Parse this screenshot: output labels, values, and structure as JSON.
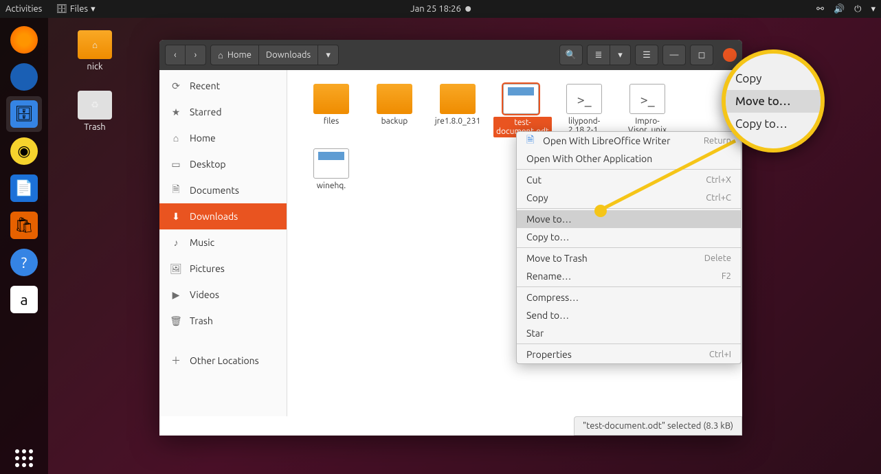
{
  "topbar": {
    "activities": "Activities",
    "app_label": "Files",
    "datetime": "Jan 25  18:26"
  },
  "desktop": {
    "home_label": "nick",
    "trash_label": "Trash"
  },
  "dock": {
    "firefox": "Firefox",
    "thunderbird": "Thunderbird",
    "files": "Files",
    "rhythmbox": "Rhythmbox",
    "writer": "LibreOffice Writer",
    "software": "Ubuntu Software",
    "help": "Help",
    "amazon": "Amazon"
  },
  "header": {
    "path_home": "Home",
    "path_current": "Downloads"
  },
  "sidebar": {
    "items": [
      {
        "icon": "⟳",
        "label": "Recent"
      },
      {
        "icon": "★",
        "label": "Starred"
      },
      {
        "icon": "⌂",
        "label": "Home"
      },
      {
        "icon": "▭",
        "label": "Desktop"
      },
      {
        "icon": "🗎",
        "label": "Documents"
      },
      {
        "icon": "⬇",
        "label": "Downloads"
      },
      {
        "icon": "♪",
        "label": "Music"
      },
      {
        "icon": "🖼",
        "label": "Pictures"
      },
      {
        "icon": "▶",
        "label": "Videos"
      },
      {
        "icon": "🗑",
        "label": "Trash"
      },
      {
        "icon": "＋",
        "label": "Other Locations"
      }
    ],
    "active_index": 5
  },
  "files": [
    {
      "name": "files",
      "type": "folder"
    },
    {
      "name": "backup",
      "type": "folder"
    },
    {
      "name": "jre1.8.0_231",
      "type": "folder"
    },
    {
      "name": "test-document.odt",
      "type": "doc",
      "selected": true
    },
    {
      "name": "lilypond-2.18.2-1.",
      "type": "script"
    },
    {
      "name": "Impro-Visor_unix",
      "type": "script"
    },
    {
      "name": "winehq.",
      "type": "doc"
    }
  ],
  "context_menu": {
    "items": [
      {
        "label": "Open With LibreOffice Writer",
        "shortcut": "Return",
        "icon": true
      },
      {
        "label": "Open With Other Application"
      },
      {
        "sep": true
      },
      {
        "label": "Cut",
        "shortcut": "Ctrl+X"
      },
      {
        "label": "Copy",
        "shortcut": "Ctrl+C"
      },
      {
        "sep": true
      },
      {
        "label": "Move to…",
        "highlighted": true
      },
      {
        "label": "Copy to…"
      },
      {
        "sep": true
      },
      {
        "label": "Move to Trash",
        "shortcut": "Delete"
      },
      {
        "label": "Rename…",
        "shortcut": "F2"
      },
      {
        "sep": true
      },
      {
        "label": "Compress…"
      },
      {
        "label": "Send to…"
      },
      {
        "label": "Star"
      },
      {
        "sep": true
      },
      {
        "label": "Properties",
        "shortcut": "Ctrl+I"
      }
    ]
  },
  "callout": {
    "copy": "Copy",
    "move_to": "Move to…",
    "copy_to": "Copy to…"
  },
  "statusbar": {
    "text": "\"test-document.odt\" selected  (8.3 kB)"
  }
}
